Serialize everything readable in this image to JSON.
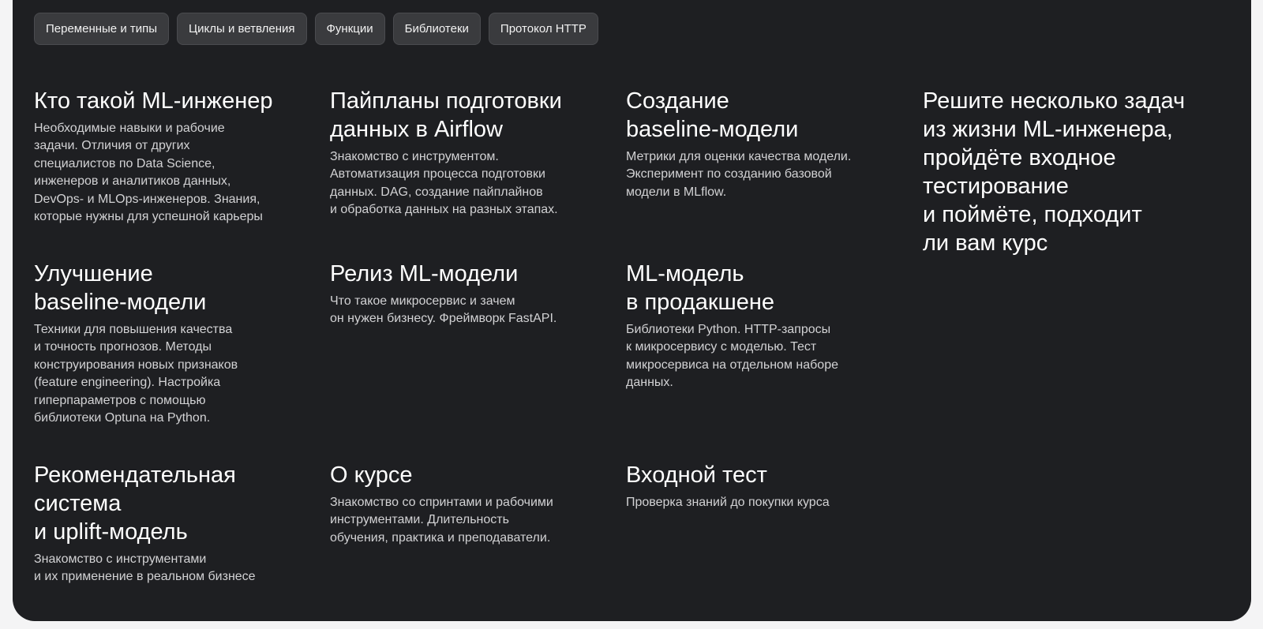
{
  "tags": [
    "Переменные и типы",
    "Циклы и ветвления",
    "Функции",
    "Библиотеки",
    "Протокол HTTP"
  ],
  "modules": [
    {
      "title": "Кто такой ML-инженер",
      "desc": "Необходимые навыки и рабочие\nзадачи. Отличия от других\nспециалистов по Data Science,\nинженеров и аналитиков данных,\nDevOps- и MLOps-инженеров. Знания,\nкоторые нужны для успешной карьеры"
    },
    {
      "title": "Пайпланы подготовки\nданных в Airflow",
      "desc": "Знакомство с инструментом.\nАвтоматизация процесса подготовки\nданных. DAG, создание пайплайнов\nи обработка данных на разных этапах."
    },
    {
      "title": "Создание\nbaseline-модели",
      "desc": "Метрики для оценки качества модели.\nЭксперимент по созданию базовой\nмодели в MLflow."
    },
    {
      "title": "Улучшение\nbaseline-модели",
      "desc": "Техники для повышения качества\nи точность прогнозов. Методы\nконструирования новых признаков\n(feature engineering). Настройка\nгиперпараметров с помощью\nбиблиотеки Optuna на Python."
    },
    {
      "title": "Релиз ML-модели",
      "desc": "Что такое микросервис и зачем\nон нужен бизнесу. Фреймворк FastAPI."
    },
    {
      "title": "ML-модель\nв продакшене",
      "desc": "Библиотеки Python. HTTP-запросы\nк микросервису с моделью. Тест\nмикросервиса на отдельном наборе\nданных."
    },
    {
      "title": "Рекомендательная\nсистема\nи uplift-модель",
      "desc": "Знакомство с инструментами\nи их применение в реальном бизнесе"
    },
    {
      "title": "О курсе",
      "desc": "Знакомство со спринтами и рабочими\nинструментами. Длительность\nобучения, практика и преподаватели."
    },
    {
      "title": "Входной тест",
      "desc": "Проверка знаний до покупки курса"
    }
  ],
  "cta": {
    "text": "Решите несколько задач\nиз жизни ML-инженера,\nпройдёте входное\nтестирование\nи поймёте, подходит\nли вам курс"
  }
}
